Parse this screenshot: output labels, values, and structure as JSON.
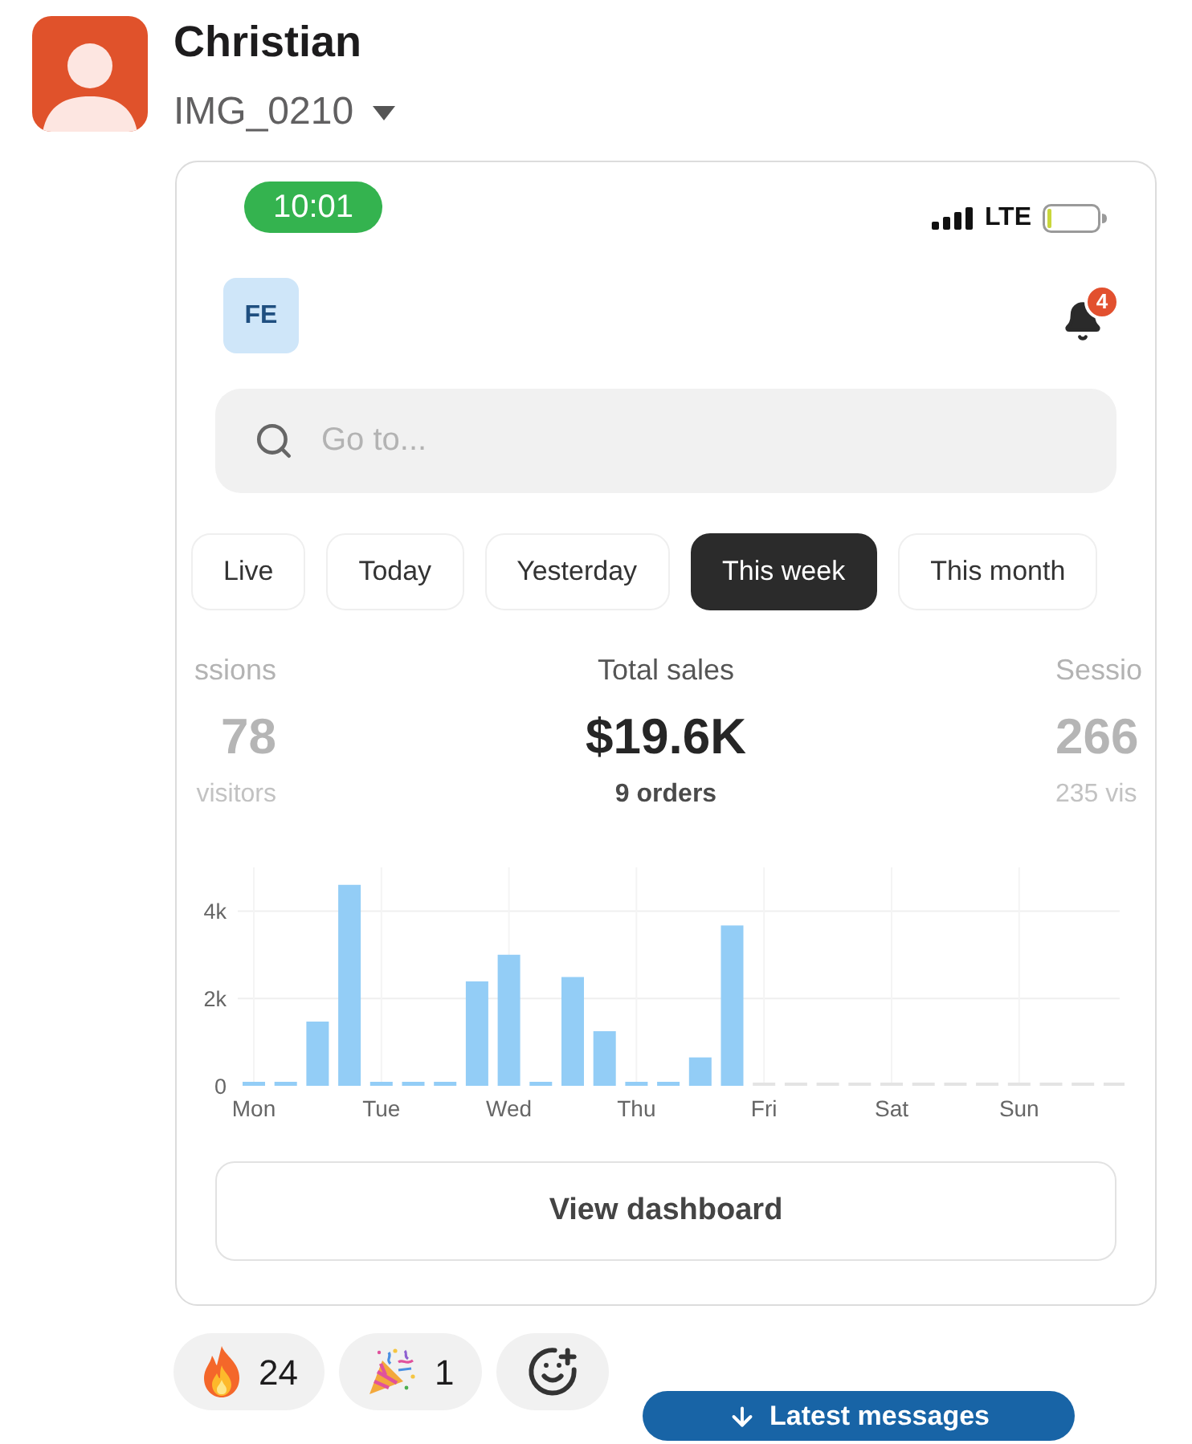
{
  "message": {
    "author": "Christian",
    "attachment": {
      "name": "IMG_0210"
    }
  },
  "screenshot": {
    "status_bar": {
      "time": "10:01",
      "network": "LTE"
    },
    "header": {
      "avatar_initials": "FE",
      "notification_count": "4"
    },
    "search": {
      "placeholder": "Go to..."
    },
    "tabs": [
      {
        "label": "Live",
        "selected": false
      },
      {
        "label": "Today",
        "selected": false
      },
      {
        "label": "Yesterday",
        "selected": false
      },
      {
        "label": "This week",
        "selected": true
      },
      {
        "label": "This month",
        "selected": false
      }
    ],
    "stats": [
      {
        "title": "ssions",
        "value": "78",
        "subtitle": "visitors",
        "selected": false
      },
      {
        "title": "Total sales",
        "value": "$19.6K",
        "subtitle": "9 orders",
        "selected": true
      },
      {
        "title": "Sessio",
        "value": "266",
        "subtitle": "235 vis",
        "selected": false
      }
    ],
    "chart_data": {
      "type": "bar",
      "categories": [
        "Mon",
        null,
        null,
        null,
        "Tue",
        null,
        null,
        null,
        "Wed",
        null,
        null,
        null,
        "Thu",
        null,
        null,
        null,
        "Fri",
        null,
        null,
        null,
        "Sat",
        null,
        null,
        null,
        "Sun",
        null,
        null,
        null
      ],
      "values": [
        0,
        0,
        1470,
        4600,
        0,
        0,
        0,
        2390,
        3000,
        0,
        2490,
        1250,
        0,
        0,
        650,
        3670,
        null,
        null,
        null,
        null,
        null,
        null,
        null,
        null,
        null,
        null,
        null,
        null
      ],
      "ylim": [
        0,
        5000
      ],
      "yticks": [
        {
          "value": 0,
          "label": "0"
        },
        {
          "value": 2000,
          "label": "2k"
        },
        {
          "value": 4000,
          "label": "4k"
        }
      ],
      "grid": true
    },
    "button": "View dashboard"
  },
  "reactions": [
    {
      "kind": "fire",
      "count": "24"
    },
    {
      "kind": "party",
      "count": "1"
    },
    {
      "kind": "add"
    }
  ],
  "jump_button": {
    "label": "Latest messages"
  }
}
